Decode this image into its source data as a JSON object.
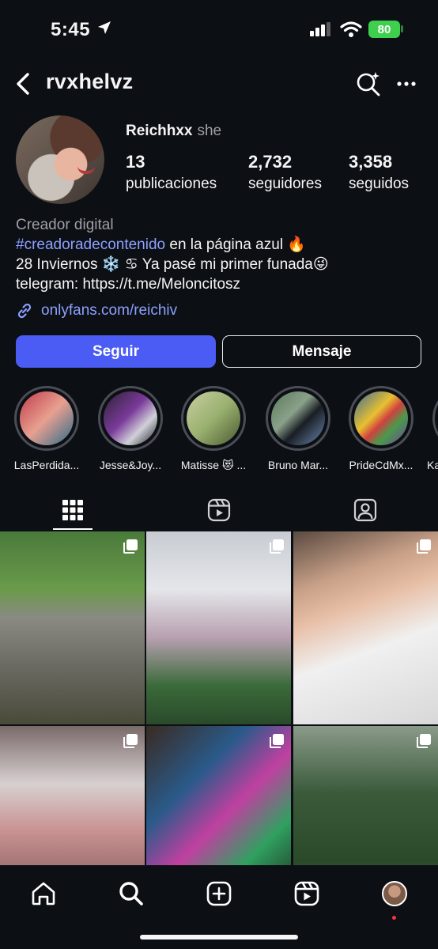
{
  "status_bar": {
    "time": "5:45",
    "battery": "80"
  },
  "header": {
    "username": "rvxhelvz"
  },
  "profile": {
    "display_name": "Reichhxx",
    "pronouns": "she",
    "stats": [
      {
        "value": "13",
        "label": "publicaciones"
      },
      {
        "value": "2,732",
        "label": "seguidores"
      },
      {
        "value": "3,358",
        "label": "seguidos"
      }
    ],
    "category": "Creador digital",
    "bio_hashtag": "#creadoradecontenido",
    "bio_line1_rest": " en la página azul 🔥",
    "bio_line2": "28 Inviernos ❄️ ♋ Ya pasé mi primer funada😜",
    "bio_line3": "telegram: https://t.me/Meloncitosz",
    "link": "onlyfans.com/reichiv"
  },
  "actions": {
    "follow": "Seguir",
    "message": "Mensaje"
  },
  "highlights": [
    {
      "label": "LasPerdida..."
    },
    {
      "label": "Jesse&Joy..."
    },
    {
      "label": "Matisse 😻 ..."
    },
    {
      "label": "Bruno Mar..."
    },
    {
      "label": "PrideCdMx..."
    },
    {
      "label": "Ka"
    }
  ],
  "tabs": [
    {
      "icon": "grid-icon"
    },
    {
      "icon": "reels-icon"
    },
    {
      "icon": "tagged-icon"
    }
  ],
  "colors": {
    "background": "#0c0f14",
    "accent": "#4a5cf4",
    "link": "#8da0ff",
    "battery": "#3ecf4e"
  }
}
